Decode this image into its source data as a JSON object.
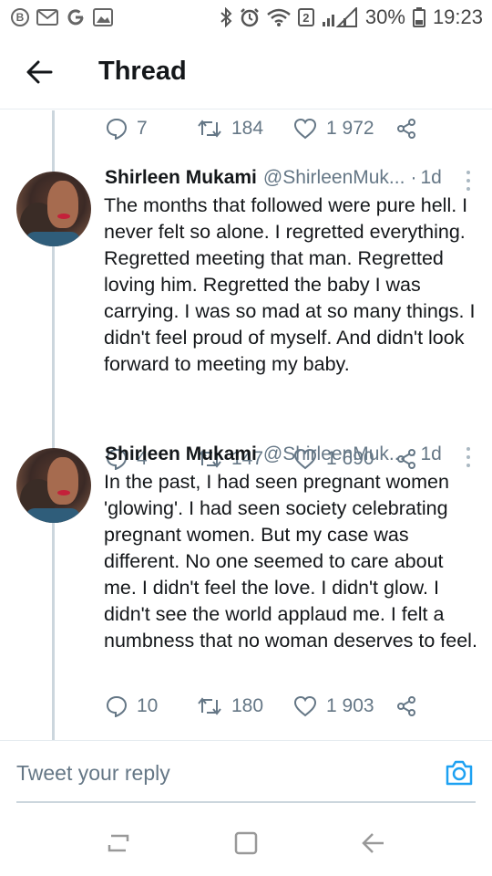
{
  "status_bar": {
    "notification_icons": [
      "b-circle-icon",
      "gmail-icon",
      "google-icon",
      "image-icon"
    ],
    "battery": "30%",
    "time": "19:23",
    "sim_badge": "2"
  },
  "app_bar": {
    "title": "Thread"
  },
  "thread": {
    "previous_tweet_actions": {
      "replies": "7",
      "retweets": "184",
      "likes": "1 972"
    },
    "tweets": [
      {
        "author": "Shirleen Mukami",
        "handle": "@ShirleenMuk...",
        "separator": "·",
        "time": "1d",
        "text": "The months that followed were pure hell. I never felt so alone. I regretted everything. Regretted meeting that man. Regretted loving him. Regretted the baby I was carrying. I was so mad at so many things. I didn't feel proud of myself. And didn't look forward to meeting my baby.",
        "replies": "4",
        "retweets": "147",
        "likes": "1 690"
      },
      {
        "author": "Shirleen Mukami",
        "handle": "@ShirleenMuk...",
        "separator": "·",
        "time": "1d",
        "text": "In the past, I had seen pregnant women 'glowing'. I had seen society celebrating pregnant women. But my case was different. No one seemed to care about me. I didn't feel the love. I didn't glow. I didn't see the world applaud me. I felt a numbness that no woman deserves to feel.",
        "replies": "10",
        "retweets": "180",
        "likes": "1 903"
      }
    ]
  },
  "reply": {
    "placeholder": "Tweet your reply"
  },
  "colors": {
    "text_primary": "#14171a",
    "text_secondary": "#657786",
    "accent": "#1da1f2",
    "divider": "#e6ecf0"
  }
}
